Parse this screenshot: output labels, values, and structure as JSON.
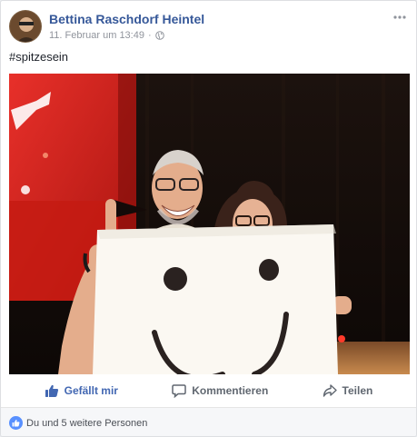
{
  "post": {
    "author": "Bettina Raschdorf Heintel",
    "timestamp": "11. Februar um 13:49",
    "separator": "·",
    "privacy_icon": "globe-icon",
    "text": "#spitzesein",
    "more_icon": "more-dots-icon"
  },
  "actions": {
    "like_label": "Gefällt mir",
    "comment_label": "Kommentieren",
    "share_label": "Teilen"
  },
  "reactions": {
    "summary": "Du und 5 weitere Personen",
    "icon": "like-badge-icon"
  },
  "colors": {
    "link_blue": "#365899",
    "like_blue": "#4267b2",
    "badge_blue": "#5890ff",
    "muted": "#90949c"
  }
}
